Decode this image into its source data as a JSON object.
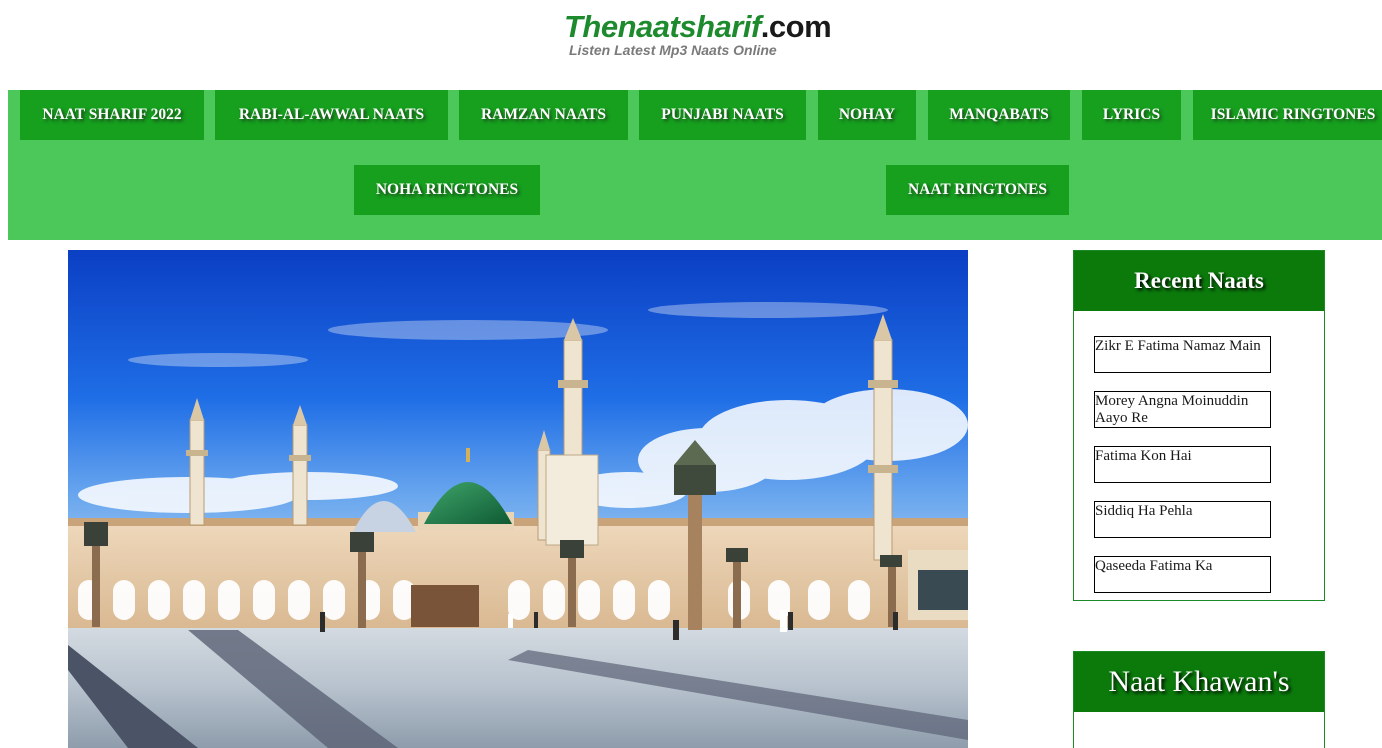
{
  "header": {
    "logo_brand": "Thenaatsharif",
    "logo_tld": ".com",
    "logo_tagline": "Listen Latest Mp3 Naats Online"
  },
  "nav": {
    "items": [
      "NAAT SHARIF 2022",
      "RABI-AL-AWWAL NAATS",
      "RAMZAN NAATS",
      "PUNJABI NAATS",
      "NOHAY",
      "MANQABATS",
      "LYRICS",
      "ISLAMIC RINGTONES",
      "NOHA RINGTONES",
      "NAAT RINGTONES"
    ]
  },
  "sidebar": {
    "recent_title": "Recent Naats",
    "recent_posts": [
      "Zikr E Fatima Namaz Main",
      "Morey Angna Moinuddin Aayo Re",
      "Fatima Kon Hai",
      "Siddiq Ha Pehla",
      "Qaseeda Fatima Ka"
    ],
    "khawans_title": "Naat Khawan's"
  },
  "colors": {
    "nav_bar": "#4cc75a",
    "nav_button": "#16a01e",
    "widget_header": "#0b7a0b",
    "logo_green": "#1e8a2e"
  }
}
